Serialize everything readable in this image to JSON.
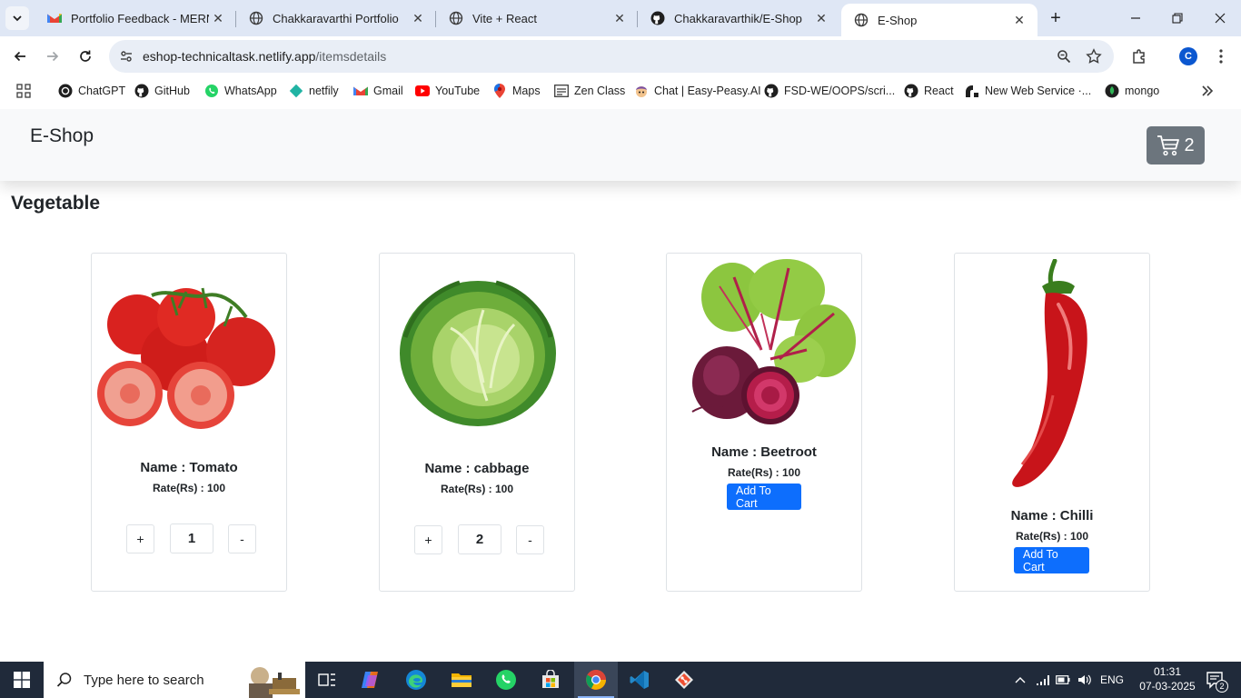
{
  "browser": {
    "tabs": [
      {
        "title": "Portfolio Feedback - MERN",
        "icon": "gmail-icon"
      },
      {
        "title": "Chakkaravarthi Portfolio",
        "icon": "globe-icon"
      },
      {
        "title": "Vite + React",
        "icon": "globe-icon"
      },
      {
        "title": "Chakkaravarthik/E-Shop",
        "icon": "github-icon"
      },
      {
        "title": "E-Shop",
        "icon": "globe-icon",
        "active": true
      }
    ],
    "url_host": "eshop-technicaltask.netlify.app",
    "url_path": "/itemsdetails",
    "profile_initial": "C",
    "bookmarks": [
      "ChatGPT",
      "GitHub",
      "WhatsApp",
      "netfily",
      "Gmail",
      "YouTube",
      "Maps",
      "Zen Class",
      "Chat | Easy-Peasy.AI",
      "FSD-WE/OOPS/scri...",
      "React",
      "New Web Service ·...",
      "mongo"
    ]
  },
  "app": {
    "brand": "E-Shop",
    "cart_count": "2",
    "section_title": "Vegetable"
  },
  "products": [
    {
      "name": "Name : Tomato",
      "rate": "Rate(Rs) : 100",
      "in_cart": true,
      "qty": "1",
      "plus": "+",
      "minus": "-"
    },
    {
      "name": "Name : cabbage",
      "rate": "Rate(Rs) : 100",
      "in_cart": true,
      "qty": "2",
      "plus": "+",
      "minus": "-"
    },
    {
      "name": "Name : Beetroot",
      "rate": "Rate(Rs) : 100",
      "in_cart": false,
      "button": "Add To Cart"
    },
    {
      "name": "Name : Chilli",
      "rate": "Rate(Rs) : 100",
      "in_cart": false,
      "button": "Add To Cart"
    }
  ],
  "taskbar": {
    "search_placeholder": "Type here to search",
    "language": "ENG",
    "time": "01:31",
    "date": "07-03-2025",
    "notification_count": "2"
  },
  "colors": {
    "primary": "#0d6efd",
    "cart_button": "#6c757d",
    "navbar_bg": "#f8f9fa"
  }
}
